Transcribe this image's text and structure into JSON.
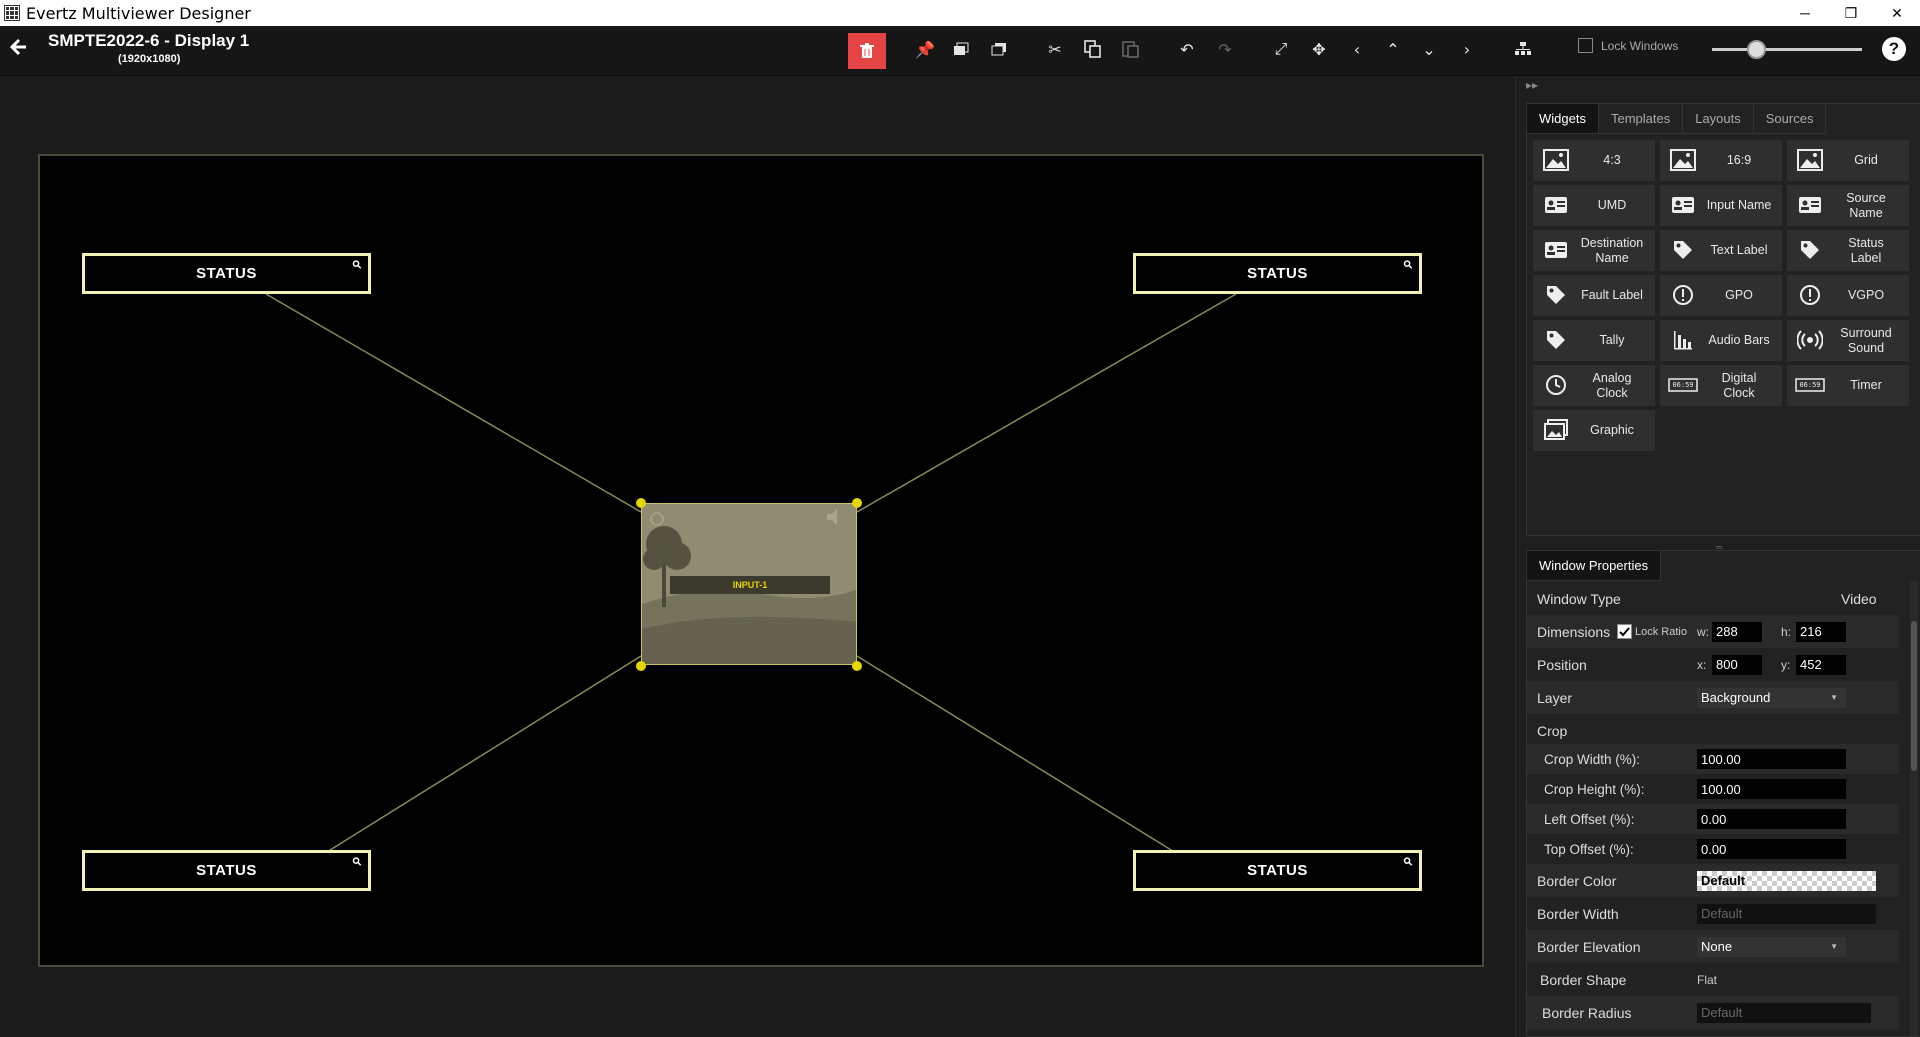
{
  "window": {
    "title": "Evertz Multiviewer Designer",
    "minimize": "─",
    "maximize": "❐",
    "close": "✕"
  },
  "header": {
    "title": "SMPTE2022-6 - Display 1",
    "subtitle": "(1920x1080)",
    "lock_windows_label": "Lock Windows",
    "help": "?"
  },
  "canvas": {
    "status_widgets": [
      {
        "label": "STATUS"
      },
      {
        "label": "STATUS"
      },
      {
        "label": "STATUS"
      },
      {
        "label": "STATUS"
      }
    ],
    "video_window": {
      "input_label": "INPUT-1"
    }
  },
  "widgets_panel": {
    "tabs": [
      "Widgets",
      "Templates",
      "Layouts",
      "Sources"
    ],
    "items": [
      {
        "label": "4:3",
        "icon": "image-icon"
      },
      {
        "label": "16:9",
        "icon": "image-icon"
      },
      {
        "label": "Grid",
        "icon": "image-icon"
      },
      {
        "label": "UMD",
        "icon": "id-card-icon"
      },
      {
        "label": "Input Name",
        "icon": "id-card-icon"
      },
      {
        "label": "Source\nName",
        "icon": "id-card-icon"
      },
      {
        "label": "Destination\nName",
        "icon": "id-card-icon"
      },
      {
        "label": "Text Label",
        "icon": "tag-icon"
      },
      {
        "label": "Status\nLabel",
        "icon": "tag-icon"
      },
      {
        "label": "Fault Label",
        "icon": "tag-icon"
      },
      {
        "label": "GPO",
        "icon": "alert-icon"
      },
      {
        "label": "VGPO",
        "icon": "alert-icon"
      },
      {
        "label": "Tally",
        "icon": "tag-icon"
      },
      {
        "label": "Audio Bars",
        "icon": "bar-chart-icon"
      },
      {
        "label": "Surround\nSound",
        "icon": "broadcast-icon"
      },
      {
        "label": "Analog\nClock",
        "icon": "clock-icon"
      },
      {
        "label": "Digital\nClock",
        "icon": "digital-clock-icon"
      },
      {
        "label": "Timer",
        "icon": "timer-icon"
      },
      {
        "label": "Graphic",
        "icon": "graphic-icon"
      }
    ],
    "digital_readout": "06:59"
  },
  "properties": {
    "tab": "Window Properties",
    "window_type_label": "Window Type",
    "window_type_value": "Video",
    "dimensions_label": "Dimensions",
    "lock_ratio_label": "Lock Ratio",
    "w_label": "w:",
    "w_value": "288",
    "h_label": "h:",
    "h_value": "216",
    "position_label": "Position",
    "x_label": "x:",
    "x_value": "800",
    "y_label": "y:",
    "y_value": "452",
    "layer_label": "Layer",
    "layer_value": "Background",
    "crop_label": "Crop",
    "crop_width_label": "Crop Width (%):",
    "crop_width_value": "100.00",
    "crop_height_label": "Crop Height (%):",
    "crop_height_value": "100.00",
    "left_offset_label": "Left Offset (%):",
    "left_offset_value": "0.00",
    "top_offset_label": "Top Offset (%):",
    "top_offset_value": "0.00",
    "border_color_label": "Border Color",
    "border_color_value": "Default",
    "border_width_label": "Border Width",
    "border_width_placeholder": "Default",
    "border_elevation_label": "Border Elevation",
    "border_elevation_value": "None",
    "border_shape_label": "Border Shape",
    "border_shape_value": "Flat",
    "border_radius_label": "Border Radius",
    "border_radius_placeholder": "Default"
  },
  "colors": {
    "accent_yellow": "#e6d600",
    "delete_red": "#e54444",
    "status_border": "#f2f0b4"
  }
}
